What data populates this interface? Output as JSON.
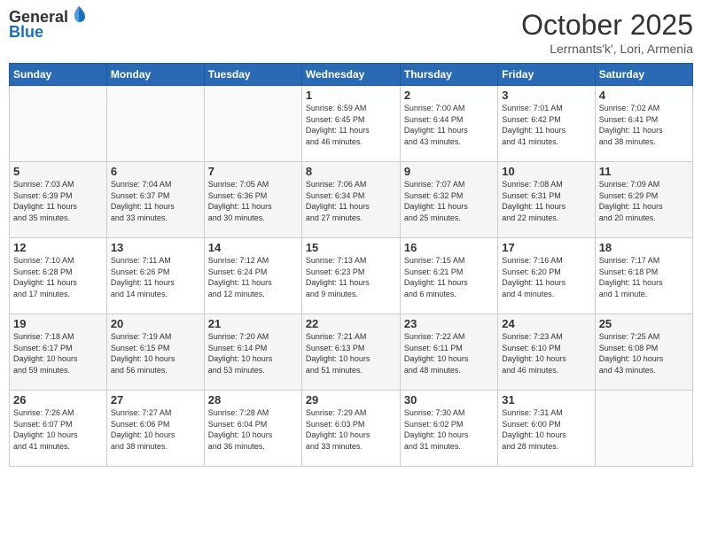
{
  "header": {
    "logo_general": "General",
    "logo_blue": "Blue",
    "month_title": "October 2025",
    "location": "Lerrnants'k', Lori, Armenia"
  },
  "days_of_week": [
    "Sunday",
    "Monday",
    "Tuesday",
    "Wednesday",
    "Thursday",
    "Friday",
    "Saturday"
  ],
  "weeks": [
    [
      {
        "day": null,
        "info": ""
      },
      {
        "day": null,
        "info": ""
      },
      {
        "day": null,
        "info": ""
      },
      {
        "day": "1",
        "info": "Sunrise: 6:59 AM\nSunset: 6:45 PM\nDaylight: 11 hours\nand 46 minutes."
      },
      {
        "day": "2",
        "info": "Sunrise: 7:00 AM\nSunset: 6:44 PM\nDaylight: 11 hours\nand 43 minutes."
      },
      {
        "day": "3",
        "info": "Sunrise: 7:01 AM\nSunset: 6:42 PM\nDaylight: 11 hours\nand 41 minutes."
      },
      {
        "day": "4",
        "info": "Sunrise: 7:02 AM\nSunset: 6:41 PM\nDaylight: 11 hours\nand 38 minutes."
      }
    ],
    [
      {
        "day": "5",
        "info": "Sunrise: 7:03 AM\nSunset: 6:39 PM\nDaylight: 11 hours\nand 35 minutes."
      },
      {
        "day": "6",
        "info": "Sunrise: 7:04 AM\nSunset: 6:37 PM\nDaylight: 11 hours\nand 33 minutes."
      },
      {
        "day": "7",
        "info": "Sunrise: 7:05 AM\nSunset: 6:36 PM\nDaylight: 11 hours\nand 30 minutes."
      },
      {
        "day": "8",
        "info": "Sunrise: 7:06 AM\nSunset: 6:34 PM\nDaylight: 11 hours\nand 27 minutes."
      },
      {
        "day": "9",
        "info": "Sunrise: 7:07 AM\nSunset: 6:32 PM\nDaylight: 11 hours\nand 25 minutes."
      },
      {
        "day": "10",
        "info": "Sunrise: 7:08 AM\nSunset: 6:31 PM\nDaylight: 11 hours\nand 22 minutes."
      },
      {
        "day": "11",
        "info": "Sunrise: 7:09 AM\nSunset: 6:29 PM\nDaylight: 11 hours\nand 20 minutes."
      }
    ],
    [
      {
        "day": "12",
        "info": "Sunrise: 7:10 AM\nSunset: 6:28 PM\nDaylight: 11 hours\nand 17 minutes."
      },
      {
        "day": "13",
        "info": "Sunrise: 7:11 AM\nSunset: 6:26 PM\nDaylight: 11 hours\nand 14 minutes."
      },
      {
        "day": "14",
        "info": "Sunrise: 7:12 AM\nSunset: 6:24 PM\nDaylight: 11 hours\nand 12 minutes."
      },
      {
        "day": "15",
        "info": "Sunrise: 7:13 AM\nSunset: 6:23 PM\nDaylight: 11 hours\nand 9 minutes."
      },
      {
        "day": "16",
        "info": "Sunrise: 7:15 AM\nSunset: 6:21 PM\nDaylight: 11 hours\nand 6 minutes."
      },
      {
        "day": "17",
        "info": "Sunrise: 7:16 AM\nSunset: 6:20 PM\nDaylight: 11 hours\nand 4 minutes."
      },
      {
        "day": "18",
        "info": "Sunrise: 7:17 AM\nSunset: 6:18 PM\nDaylight: 11 hours\nand 1 minute."
      }
    ],
    [
      {
        "day": "19",
        "info": "Sunrise: 7:18 AM\nSunset: 6:17 PM\nDaylight: 10 hours\nand 59 minutes."
      },
      {
        "day": "20",
        "info": "Sunrise: 7:19 AM\nSunset: 6:15 PM\nDaylight: 10 hours\nand 56 minutes."
      },
      {
        "day": "21",
        "info": "Sunrise: 7:20 AM\nSunset: 6:14 PM\nDaylight: 10 hours\nand 53 minutes."
      },
      {
        "day": "22",
        "info": "Sunrise: 7:21 AM\nSunset: 6:13 PM\nDaylight: 10 hours\nand 51 minutes."
      },
      {
        "day": "23",
        "info": "Sunrise: 7:22 AM\nSunset: 6:11 PM\nDaylight: 10 hours\nand 48 minutes."
      },
      {
        "day": "24",
        "info": "Sunrise: 7:23 AM\nSunset: 6:10 PM\nDaylight: 10 hours\nand 46 minutes."
      },
      {
        "day": "25",
        "info": "Sunrise: 7:25 AM\nSunset: 6:08 PM\nDaylight: 10 hours\nand 43 minutes."
      }
    ],
    [
      {
        "day": "26",
        "info": "Sunrise: 7:26 AM\nSunset: 6:07 PM\nDaylight: 10 hours\nand 41 minutes."
      },
      {
        "day": "27",
        "info": "Sunrise: 7:27 AM\nSunset: 6:06 PM\nDaylight: 10 hours\nand 38 minutes."
      },
      {
        "day": "28",
        "info": "Sunrise: 7:28 AM\nSunset: 6:04 PM\nDaylight: 10 hours\nand 36 minutes."
      },
      {
        "day": "29",
        "info": "Sunrise: 7:29 AM\nSunset: 6:03 PM\nDaylight: 10 hours\nand 33 minutes."
      },
      {
        "day": "30",
        "info": "Sunrise: 7:30 AM\nSunset: 6:02 PM\nDaylight: 10 hours\nand 31 minutes."
      },
      {
        "day": "31",
        "info": "Sunrise: 7:31 AM\nSunset: 6:00 PM\nDaylight: 10 hours\nand 28 minutes."
      },
      {
        "day": null,
        "info": ""
      }
    ]
  ]
}
